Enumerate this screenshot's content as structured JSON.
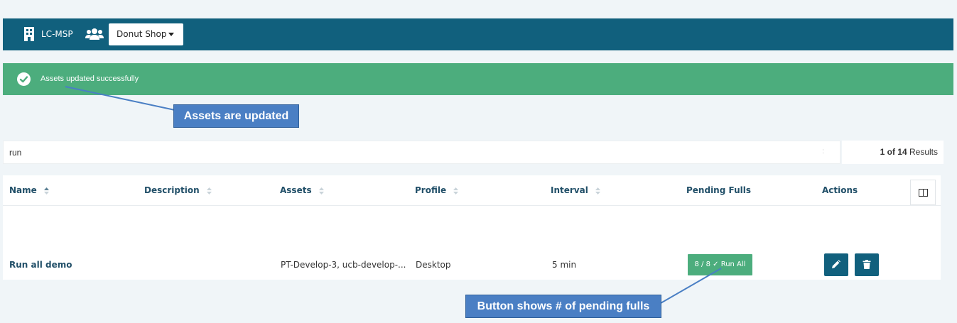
{
  "topbar": {
    "org_name": "LC-MSP",
    "org_icon": "building-icon",
    "users_icon": "users-icon",
    "tenant_selected": "Donut Shop"
  },
  "alert": {
    "message": "Assets updated successfully",
    "icon": "check-circle-icon",
    "color": "#4cad7d"
  },
  "annotations": {
    "assets_updated": "Assets are updated",
    "pending_fulls": "Button shows # of pending fulls"
  },
  "search": {
    "value": "run",
    "separator": ":"
  },
  "results": {
    "count": "1 of 14",
    "label": "Results"
  },
  "table": {
    "columns": {
      "name": "Name",
      "description": "Description",
      "assets": "Assets",
      "profile": "Profile",
      "interval": "Interval",
      "pending_fulls": "Pending Fulls",
      "actions": "Actions"
    },
    "rows": [
      {
        "name": "Run all demo",
        "description": "",
        "assets": "PT-Develop-3, ucb-develop-...",
        "profile": "Desktop",
        "interval": "5 min",
        "run_all_label": "8 / 8 ✓ Run All"
      }
    ]
  },
  "colors": {
    "topbar": "#11607d",
    "success": "#4cad7d",
    "callout": "#4a7fc4",
    "background": "#f0f5f8"
  }
}
